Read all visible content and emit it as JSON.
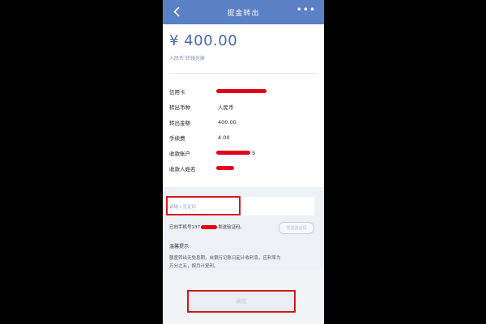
{
  "header": {
    "title": "提金转出",
    "more": "•••"
  },
  "amount": {
    "value": "¥ 400.00",
    "note": "人民币 钞钱兑换"
  },
  "details": [
    {
      "label": "信用卡",
      "value": ""
    },
    {
      "label": "转出币种",
      "value": "人民币"
    },
    {
      "label": "转出金额",
      "value": "400.00"
    },
    {
      "label": "手续费",
      "value": "4.00"
    },
    {
      "label": "收款账户",
      "value": "5"
    },
    {
      "label": "收款人姓名",
      "value": ""
    }
  ],
  "verification": {
    "placeholder": "请输入验证码",
    "sms_prefix": "已向手机号137",
    "sms_suffix": "发送验证码。",
    "send_button": "发送验证码"
  },
  "tips": {
    "title": "温馨提示",
    "line1": "额度转出无免息期，自银行记账日起计收利息，应利率为",
    "line2": "万分之五，按月计复利。"
  },
  "confirm_button": "确定",
  "colors": {
    "nav": "#5a80c6",
    "amount": "#4b67b3",
    "highlight": "#d6171f",
    "redaction": "#e2001a"
  }
}
